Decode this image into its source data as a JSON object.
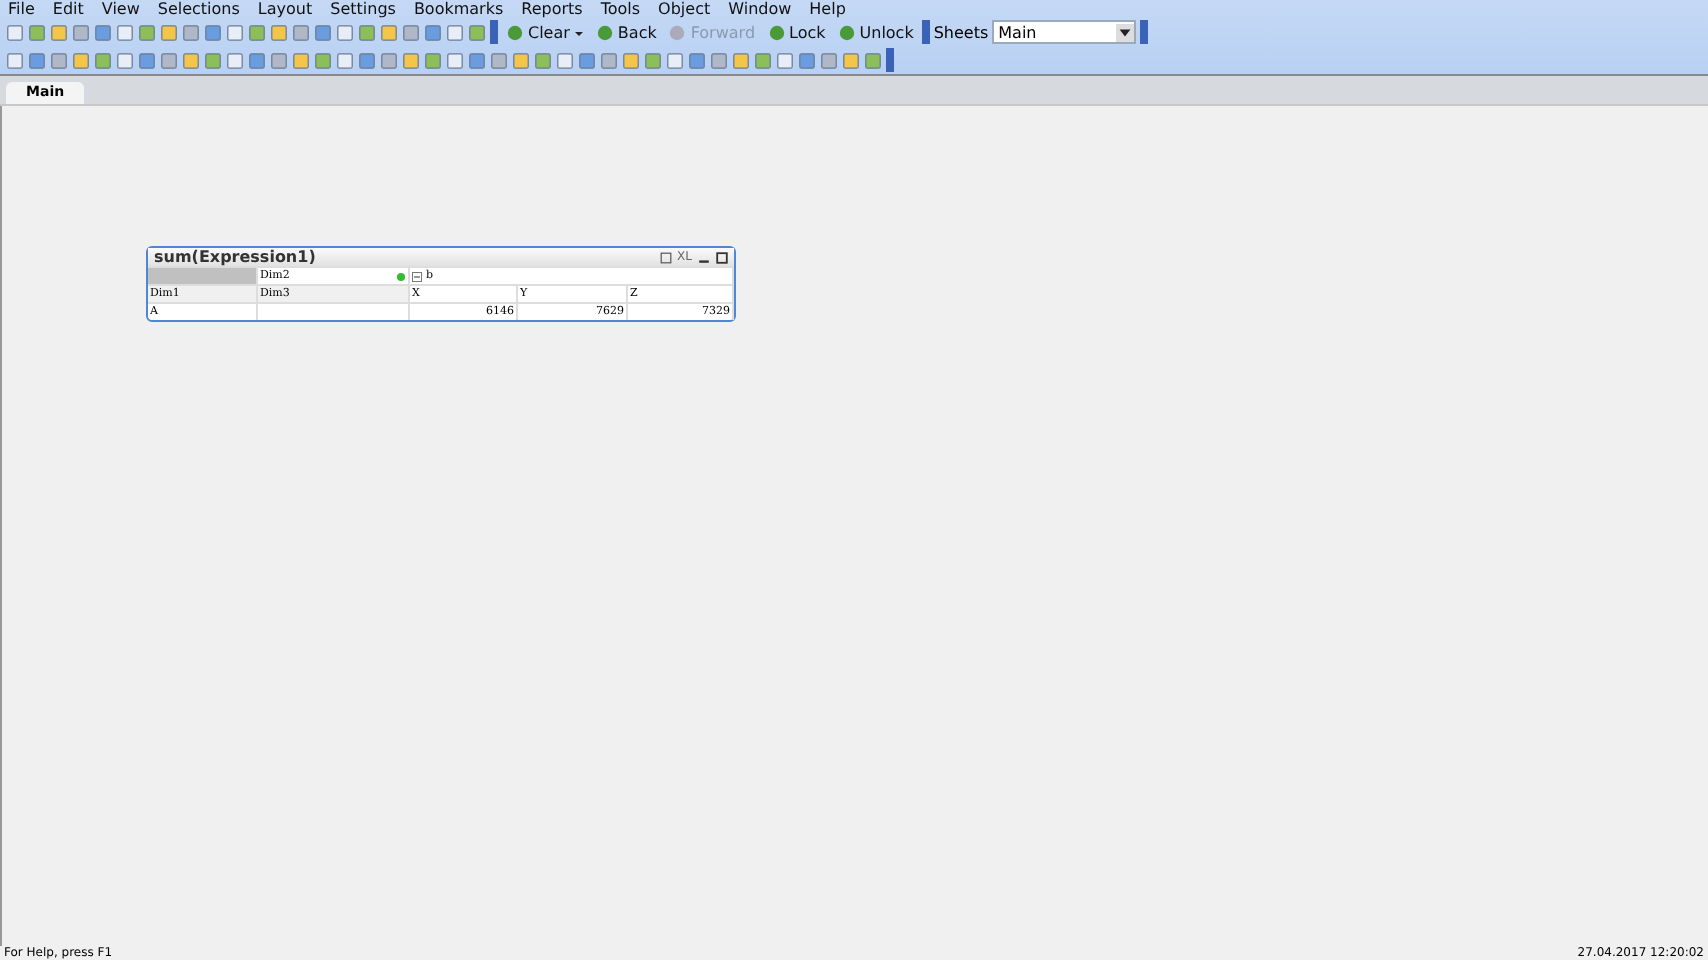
{
  "menu": [
    "File",
    "Edit",
    "View",
    "Selections",
    "Layout",
    "Settings",
    "Bookmarks",
    "Reports",
    "Tools",
    "Object",
    "Window",
    "Help"
  ],
  "toolbar": {
    "buttons": [
      {
        "kind": "dropdown",
        "label": "Clear",
        "disabled": false
      },
      {
        "kind": "plain",
        "label": "Back",
        "disabled": false
      },
      {
        "kind": "plain",
        "label": "Forward",
        "disabled": true
      },
      {
        "kind": "plain",
        "label": "Lock",
        "disabled": false
      },
      {
        "kind": "plain",
        "label": "Unlock",
        "disabled": false
      }
    ],
    "sheets_label": "Sheets",
    "sheets_value": "Main"
  },
  "tabs": [
    {
      "label": "Main",
      "selected": true
    }
  ],
  "object": {
    "title": "sum(Expression1)",
    "caption_buttons": [
      "XL"
    ],
    "header_row": {
      "dim": "Dim2",
      "expand": "b"
    },
    "dims_row": [
      "Dim1",
      "Dim3",
      "X",
      "Y",
      "Z"
    ],
    "rows": [
      [
        "A",
        "",
        "6146",
        "7629",
        "7329"
      ]
    ]
  },
  "status_bar": {
    "left": "For Help, press F1",
    "right": "27.04.2017 12:20:02"
  }
}
